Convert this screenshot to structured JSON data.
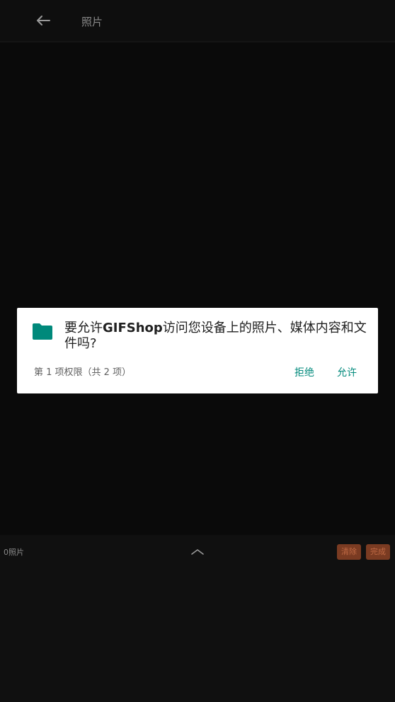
{
  "topbar": {
    "back_icon": "arrow-left-icon",
    "title": "照片"
  },
  "dialog": {
    "icon": "folder-icon",
    "icon_color": "#00897b",
    "message_prefix": "要允许",
    "app_name": "GIFShop",
    "message_suffix": "访问您设备上的照片、媒体内容和文件吗?",
    "counter": "第 1 项权限（共 2 项）",
    "deny_label": "拒绝",
    "allow_label": "允许",
    "accent": "#00897b"
  },
  "bottom": {
    "photo_count": "0照片",
    "expand_icon": "chevron-up-icon",
    "clear_label": "清除",
    "done_label": "完成",
    "chip_color": "#7a3b22"
  }
}
